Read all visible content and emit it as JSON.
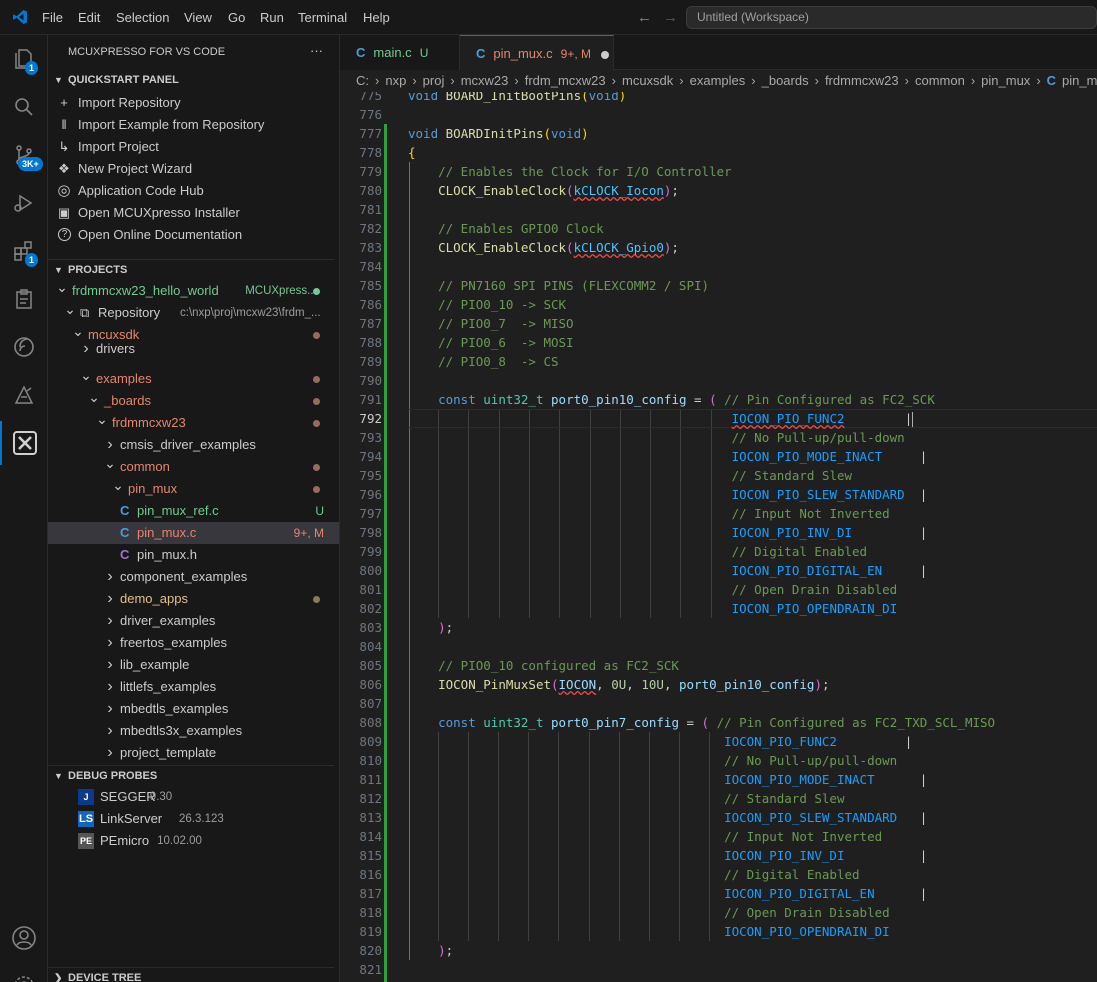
{
  "menu": [
    "File",
    "Edit",
    "Selection",
    "View",
    "Go",
    "Run",
    "Terminal",
    "Help"
  ],
  "search_text": "Untitled (Workspace)",
  "activity_badges": {
    "explorer": "1",
    "source_control": "3K+",
    "extensions": "1"
  },
  "sidebar": {
    "title": "MCUXPRESSO FOR VS CODE",
    "more": "···",
    "quickstart_header": "QUICKSTART PANEL",
    "quickstart": [
      {
        "icon": "plus-icon",
        "label": "Import Repository"
      },
      {
        "icon": "library-icon",
        "label": "Import Example from Repository"
      },
      {
        "icon": "import-project-icon",
        "label": "Import Project"
      },
      {
        "icon": "wizard-icon",
        "label": "New Project Wizard"
      },
      {
        "icon": "globe-icon",
        "label": "Application Code Hub"
      },
      {
        "icon": "installer-icon",
        "label": "Open MCUXpresso Installer"
      },
      {
        "icon": "help-icon",
        "label": "Open Online Documentation"
      }
    ],
    "projects_header": "PROJECTS",
    "tree": [
      {
        "depth": 0,
        "chev": "v",
        "label": "frdmmcxw23_hello_world",
        "desc": "MCUXpress...",
        "color": "#73c991",
        "dot": "#73c991"
      },
      {
        "depth": 1,
        "chev": "v",
        "icon": "repo",
        "label": "Repository",
        "desc": "c:\\nxp\\proj\\mcxw23\\frdm_...",
        "color": "#cccccc"
      },
      {
        "depth": 2,
        "chev": "v",
        "label": "mcuxsdk",
        "color": "#e2876f",
        "dot": "#9b6a5c"
      },
      {
        "depth": 3,
        "chev": ">",
        "label": "drivers",
        "color": "#cccccc",
        "partial": true
      },
      {
        "depth": 3,
        "chev": "v",
        "label": "examples",
        "color": "#e2876f",
        "dot": "#9b6a5c"
      },
      {
        "depth": 4,
        "chev": "v",
        "label": "_boards",
        "color": "#e2876f",
        "dot": "#9b6a5c"
      },
      {
        "depth": 5,
        "chev": "v",
        "label": "frdmmcxw23",
        "color": "#e2876f",
        "dot": "#9b6a5c"
      },
      {
        "depth": 6,
        "chev": ">",
        "label": "cmsis_driver_examples",
        "color": "#cccccc"
      },
      {
        "depth": 6,
        "chev": "v",
        "label": "common",
        "color": "#e2876f",
        "dot": "#9b6a5c"
      },
      {
        "depth": 7,
        "chev": "v",
        "label": "pin_mux",
        "color": "#e2876f",
        "dot": "#9b6a5c"
      },
      {
        "depth": 8,
        "file": "C",
        "label": "pin_mux_ref.c",
        "color": "#73c991",
        "status": "U",
        "status_color": "#73c991"
      },
      {
        "depth": 8,
        "file": "C",
        "label": "pin_mux.c",
        "color": "#e2876f",
        "status": "9+, M",
        "status_color": "#e2876f",
        "selected": true
      },
      {
        "depth": 8,
        "file": "C",
        "label": "pin_mux.h",
        "color": "#cccccc",
        "file_color": "#a074c4"
      },
      {
        "depth": 6,
        "chev": ">",
        "label": "component_examples",
        "color": "#cccccc"
      },
      {
        "depth": 6,
        "chev": ">",
        "label": "demo_apps",
        "color": "#e2c08d",
        "dot": "#8a7a5c"
      },
      {
        "depth": 6,
        "chev": ">",
        "label": "driver_examples",
        "color": "#cccccc"
      },
      {
        "depth": 6,
        "chev": ">",
        "label": "freertos_examples",
        "color": "#cccccc"
      },
      {
        "depth": 6,
        "chev": ">",
        "label": "lib_example",
        "color": "#cccccc"
      },
      {
        "depth": 6,
        "chev": ">",
        "label": "littlefs_examples",
        "color": "#cccccc"
      },
      {
        "depth": 6,
        "chev": ">",
        "label": "mbedtls_examples",
        "color": "#cccccc"
      },
      {
        "depth": 6,
        "chev": ">",
        "label": "mbedtls3x_examples",
        "color": "#cccccc"
      },
      {
        "depth": 6,
        "chev": ">",
        "label": "project_template",
        "color": "#cccccc"
      }
    ],
    "debug_header": "DEBUG PROBES",
    "probes": [
      {
        "icon": "J",
        "label": "SEGGER",
        "version": "9.30"
      },
      {
        "icon": "LS",
        "label": "LinkServer",
        "version": "26.3.123"
      },
      {
        "icon": "PE",
        "label": "PEmicro",
        "version": "10.02.00"
      }
    ],
    "device_tree_header": "DEVICE TREE"
  },
  "tabs": [
    {
      "icon": "C",
      "label": "main.c",
      "status": "U",
      "active": false
    },
    {
      "icon": "C",
      "label": "pin_mux.c",
      "status": "9+, M",
      "active": true
    }
  ],
  "breadcrumb": [
    "C:",
    "nxp",
    "proj",
    "mcxw23",
    "frdm_mcxw23",
    "mcuxsdk",
    "examples",
    "_boards",
    "frdmmcxw23",
    "common",
    "pin_mux",
    "pin_mu"
  ],
  "breadcrumb_last_icon": "C",
  "current_line": "792",
  "code_lines": [
    {
      "n": "775",
      "h": "<span class='k'>void</span> <span class='f'>BOARD_InitBootPins</span><span class='p'>(</span><span class='k'>void</span><span class='p'>)</span>"
    },
    {
      "n": "776",
      "h": ""
    },
    {
      "n": "777",
      "h": "<span class='k'>void</span> <span class='f'>BOARDInitPins</span><span class='p'>(</span><span class='k'>void</span><span class='p'>)</span>"
    },
    {
      "n": "778",
      "h": "<span class='p'>{</span>"
    },
    {
      "n": "779",
      "h": "    <span class='c'>// Enables the Clock for I/O Controller</span>"
    },
    {
      "n": "780",
      "h": "    <span class='f'>CLOCK_EnableClock</span><span class='pp'>(</span><span class='m sq'>kCLOCK_Iocon</span><span class='pp'>)</span>;"
    },
    {
      "n": "781",
      "h": ""
    },
    {
      "n": "782",
      "h": "    <span class='c'>// Enables GPIO0 Clock</span>"
    },
    {
      "n": "783",
      "h": "    <span class='f'>CLOCK_EnableClock</span><span class='pp'>(</span><span class='m sq'>kCLOCK_Gpio0</span><span class='pp'>)</span>;"
    },
    {
      "n": "784",
      "h": ""
    },
    {
      "n": "785",
      "h": "    <span class='c'>// PN7160 SPI PINS (FLEXCOMM2 / SPI)</span>"
    },
    {
      "n": "786",
      "h": "    <span class='c'>// PIO0_10 -&gt; SCK</span>"
    },
    {
      "n": "787",
      "h": "    <span class='c'>// PIO0_7  -&gt; MISO</span>"
    },
    {
      "n": "788",
      "h": "    <span class='c'>// PIO0_6  -&gt; MOSI</span>"
    },
    {
      "n": "789",
      "h": "    <span class='c'>// PIO0_8  -&gt; CS</span>"
    },
    {
      "n": "790",
      "h": ""
    },
    {
      "n": "791",
      "h": "    <span class='k'>const</span> <span class='t'>uint32_t</span> <span class='v'>port0_pin10_config</span> = <span class='pp'>(</span> <span class='c'>// Pin Configured as FC2_SCK</span>"
    },
    {
      "n": "792",
      "h": "                                           <span class='b sq'>IOCON_PIO_FUNC2</span>        |"
    },
    {
      "n": "793",
      "h": "                                           <span class='c'>// No Pull-up/pull-down</span>"
    },
    {
      "n": "794",
      "h": "                                           <span class='b'>IOCON_PIO_MODE_INACT</span>     |"
    },
    {
      "n": "795",
      "h": "                                           <span class='c'>// Standard Slew</span>"
    },
    {
      "n": "796",
      "h": "                                           <span class='b'>IOCON_PIO_SLEW_STANDARD</span>  |"
    },
    {
      "n": "797",
      "h": "                                           <span class='c'>// Input Not Inverted</span>"
    },
    {
      "n": "798",
      "h": "                                           <span class='b'>IOCON_PIO_INV_DI</span>         |"
    },
    {
      "n": "799",
      "h": "                                           <span class='c'>// Digital Enabled</span>"
    },
    {
      "n": "800",
      "h": "                                           <span class='b'>IOCON_PIO_DIGITAL_EN</span>     |"
    },
    {
      "n": "801",
      "h": "                                           <span class='c'>// Open Drain Disabled</span>"
    },
    {
      "n": "802",
      "h": "                                           <span class='b'>IOCON_PIO_OPENDRAIN_DI</span>"
    },
    {
      "n": "803",
      "h": "    <span class='pp'>)</span>;"
    },
    {
      "n": "804",
      "h": ""
    },
    {
      "n": "805",
      "h": "    <span class='c'>// PIO0_10 configured as FC2_SCK</span>"
    },
    {
      "n": "806",
      "h": "    <span class='f'>IOCON_PinMuxSet</span><span class='pp'>(</span><span class='v sq'>IOCON</span>, <span class='n'>0U</span>, <span class='n'>10U</span>, <span class='v'>port0_pin10_config</span><span class='pp'>)</span>;"
    },
    {
      "n": "807",
      "h": ""
    },
    {
      "n": "808",
      "h": "    <span class='k'>const</span> <span class='t'>uint32_t</span> <span class='v'>port0_pin7_config</span> = <span class='pp'>(</span> <span class='c'>// Pin Configured as FC2_TXD_SCL_MISO</span>"
    },
    {
      "n": "809",
      "h": "                                          <span class='b'>IOCON_PIO_FUNC2</span>         |"
    },
    {
      "n": "810",
      "h": "                                          <span class='c'>// No Pull-up/pull-down</span>"
    },
    {
      "n": "811",
      "h": "                                          <span class='b'>IOCON_PIO_MODE_INACT</span>      |"
    },
    {
      "n": "812",
      "h": "                                          <span class='c'>// Standard Slew</span>"
    },
    {
      "n": "813",
      "h": "                                          <span class='b'>IOCON_PIO_SLEW_STANDARD</span>   |"
    },
    {
      "n": "814",
      "h": "                                          <span class='c'>// Input Not Inverted</span>"
    },
    {
      "n": "815",
      "h": "                                          <span class='b'>IOCON_PIO_INV_DI</span>          |"
    },
    {
      "n": "816",
      "h": "                                          <span class='c'>// Digital Enabled</span>"
    },
    {
      "n": "817",
      "h": "                                          <span class='b'>IOCON_PIO_DIGITAL_EN</span>      |"
    },
    {
      "n": "818",
      "h": "                                          <span class='c'>// Open Drain Disabled</span>"
    },
    {
      "n": "819",
      "h": "                                          <span class='b'>IOCON_PIO_OPENDRAIN_DI</span>"
    },
    {
      "n": "820",
      "h": "    <span class='pp'>)</span>;"
    },
    {
      "n": "821",
      "h": ""
    }
  ]
}
